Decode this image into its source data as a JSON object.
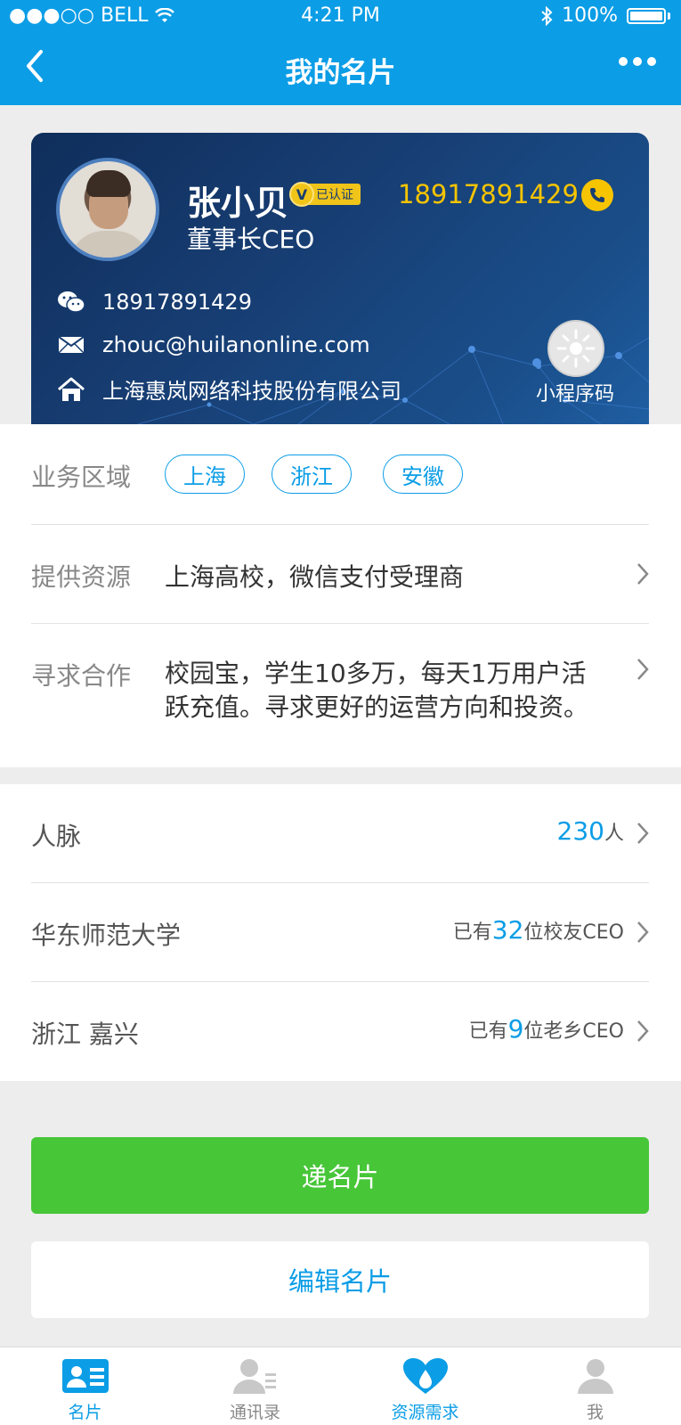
{
  "status_bar": {
    "carrier": "●●●○○ BELL",
    "time": "4:21 PM",
    "battery": "100%"
  },
  "nav": {
    "title": "我的名片"
  },
  "card": {
    "name": "张小贝",
    "verified_label": "已认证",
    "phone": "18917891429",
    "position": "董事长CEO",
    "wechat": "18917891429",
    "email": "zhouc@huilanonline.com",
    "company": "上海惠岚网络科技股份有限公司",
    "qr_label": "小程序码"
  },
  "details": {
    "business_area": {
      "label": "业务区域",
      "tags": [
        "上海",
        "浙江",
        "安徽"
      ]
    },
    "provide": {
      "label": "提供资源",
      "value": "上海高校，微信支付受理商"
    },
    "seek": {
      "label": "寻求合作",
      "line1": "校园宝，学生10多万，每天1万用户活",
      "line2": "跃充值。寻求更好的运营方向和投资。"
    }
  },
  "network": {
    "contacts": {
      "label": "人脉",
      "count": "230",
      "unit": "人"
    },
    "school": {
      "label": "华东师范大学",
      "prefix": "已有",
      "count": "32",
      "suffix": "位校友CEO"
    },
    "hometown": {
      "label": "浙江 嘉兴",
      "prefix": "已有",
      "count": "9",
      "suffix": "位老乡CEO"
    }
  },
  "buttons": {
    "send": "递名片",
    "edit": "编辑名片"
  },
  "tabbar": [
    {
      "label": "名片",
      "active": true
    },
    {
      "label": "通讯录",
      "active": false
    },
    {
      "label": "资源需求",
      "active": false
    },
    {
      "label": "我",
      "active": false
    }
  ],
  "colors": {
    "primary": "#0b9de6",
    "green": "#47c638",
    "gold": "#f6c400",
    "card_dark": "#0f2e5b"
  }
}
